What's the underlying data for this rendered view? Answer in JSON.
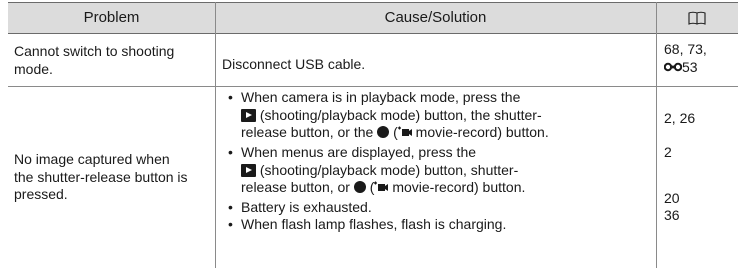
{
  "header": {
    "problem": "Problem",
    "cause": "Cause/Solution",
    "page_icon": "book-icon"
  },
  "rows": [
    {
      "problem_lines": [
        "Cannot switch to shooting",
        "mode."
      ],
      "cause_line": "Disconnect USB cable.",
      "pages_line1": "68, 73,",
      "pages_line2": "53",
      "pages_line2_icon": "reference-icon"
    },
    {
      "problem_lines": [
        "No image captured when",
        "the shutter-release button is",
        "pressed."
      ],
      "b1": {
        "l1": "When camera is in playback mode, press the",
        "l2": "(shooting/playback mode) button, the shutter-",
        "l3a": "release button, or the",
        "l3b": "(",
        "l3c": "movie-record) button."
      },
      "b2": {
        "l1": "When menus are displayed, press the",
        "l2": "(shooting/playback mode) button, shutter-",
        "l3a": "release button, or",
        "l3b": "(",
        "l3c": "movie-record) button."
      },
      "b3": "Battery is exhausted.",
      "b4": "When flash lamp flashes, flash is charging.",
      "pages": [
        "2, 26",
        "2",
        "20",
        "36"
      ]
    }
  ]
}
